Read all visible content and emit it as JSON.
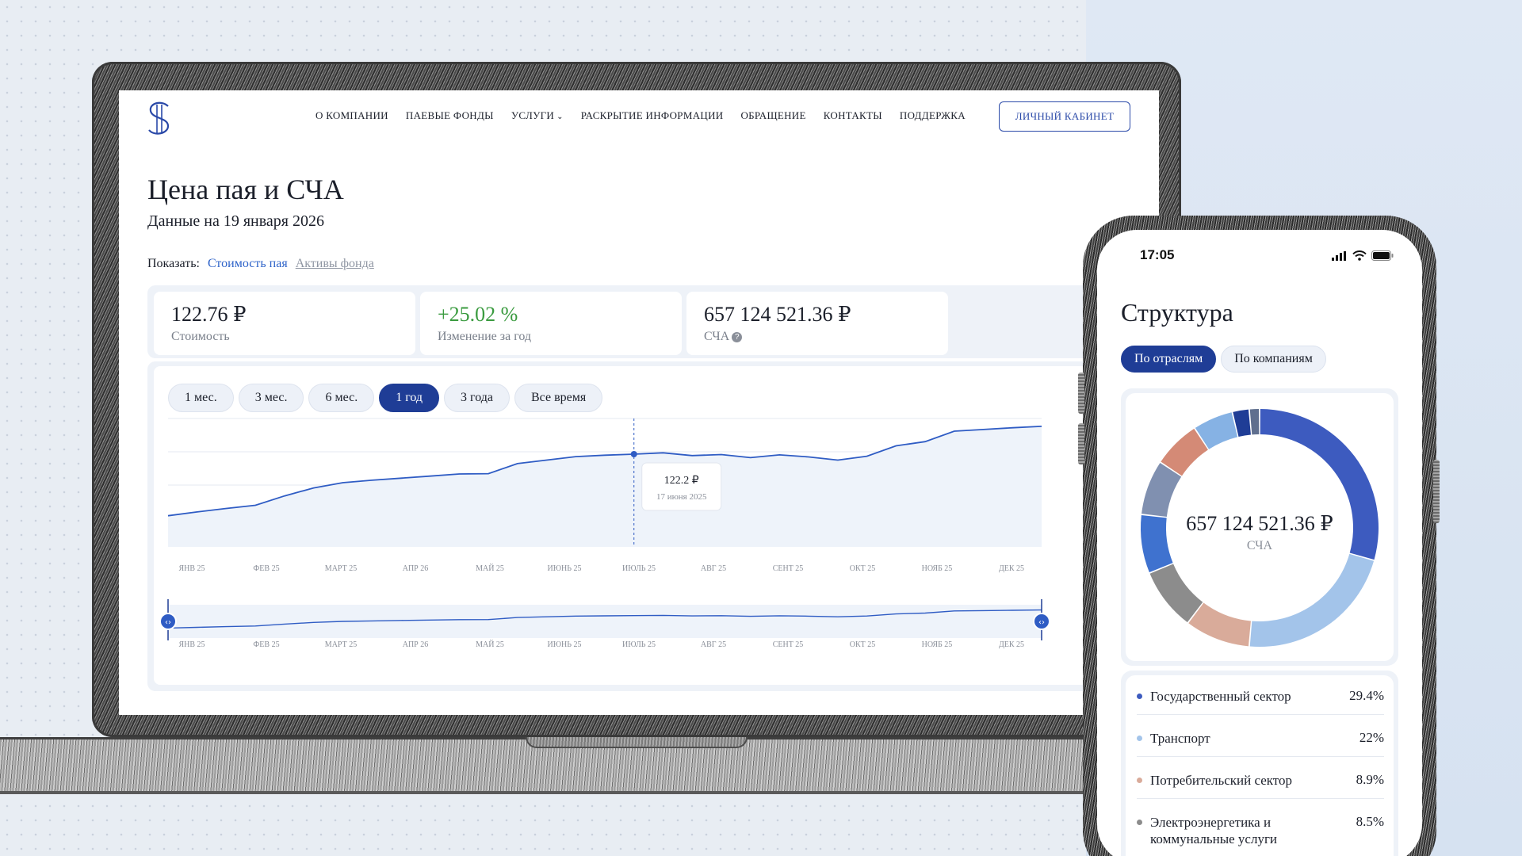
{
  "nav": {
    "items": [
      {
        "label": "О КОМПАНИИ"
      },
      {
        "label": "ПАЕВЫЕ ФОНДЫ"
      },
      {
        "label": "УСЛУГИ",
        "dropdown": true
      },
      {
        "label": "РАСКРЫТИЕ ИНФОРМАЦИИ"
      },
      {
        "label": "ОБРАЩЕНИЕ"
      },
      {
        "label": "КОНТАКТЫ"
      },
      {
        "label": "ПОДДЕРЖКА"
      }
    ],
    "cabinet_label": "ЛИЧНЫЙ КАБИНЕТ"
  },
  "page": {
    "title": "Цена пая и СЧА",
    "subtitle": "Данные на 19 января 2026",
    "show_label": "Показать:",
    "show_options": [
      "Стоимость пая",
      "Активы фонда"
    ],
    "show_selected": "Стоимость пая"
  },
  "stats": {
    "price": {
      "value": "122.76 ₽",
      "label": "Стоимость"
    },
    "change": {
      "value": "+25.02 %",
      "label": "Изменение за год"
    },
    "nav": {
      "value": "657 124 521.36 ₽",
      "label": "СЧА",
      "info_icon": "?"
    }
  },
  "periods": {
    "items": [
      "1 мес.",
      "3 мес.",
      "6 мес.",
      "1 год",
      "3 года",
      "Все время"
    ],
    "selected": "1 год"
  },
  "tooltip": {
    "value": "122.2 ₽",
    "date": "17 июня 2025"
  },
  "chart_data": {
    "type": "line",
    "x_labels": [
      "ЯНВ 25",
      "ФЕВ 25",
      "МАРТ 25",
      "АПР 26",
      "МАЙ 25",
      "ИЮНЬ 25",
      "ИЮЛЬ 25",
      "АВГ 25",
      "СЕНТ 25",
      "ОКТ 25",
      "НОЯБ 25",
      "ДЕК 25"
    ],
    "values": [
      98.5,
      99.6,
      100.6,
      101.5,
      104.2,
      106.5,
      108.0,
      108.7,
      109.3,
      109.9,
      110.5,
      110.6,
      113.5,
      114.5,
      115.5,
      115.9,
      116.2,
      116.6,
      115.8,
      116.1,
      115.2,
      116.0,
      115.4,
      114.5,
      115.6,
      118.6,
      119.8,
      122.8,
      123.3,
      123.8,
      124.2
    ],
    "highlight_index": 16,
    "line_color": "#2f5cc4",
    "fill_color": "#eef3fa"
  },
  "mobile": {
    "time": "17:05",
    "title": "Структура",
    "tabs": [
      "По отраслям",
      "По компаниям"
    ],
    "selected_tab": "По отраслям",
    "donut_value": "657 124 521.36 ₽",
    "donut_label": "СЧА",
    "structure": [
      {
        "name": "Государственный сектор",
        "pct": "29.4%",
        "value": 29.4,
        "color": "#3d5bbf"
      },
      {
        "name": "Транспорт",
        "pct": "22%",
        "value": 22,
        "color": "#a3c4ea"
      },
      {
        "name": "Потребительский сектор",
        "pct": "8.9%",
        "value": 8.9,
        "color": "#d9ab9a"
      },
      {
        "name": "Электроэнергетика и коммунальные услуги",
        "pct": "8.5%",
        "value": 8.5,
        "color": "#8c8c8c"
      }
    ],
    "donut_extra_segments": [
      {
        "value": 8.0,
        "color": "#3f72cf"
      },
      {
        "value": 7.5,
        "color": "#8090b0"
      },
      {
        "value": 6.5,
        "color": "#d48a76"
      },
      {
        "value": 5.5,
        "color": "#86b2e4"
      },
      {
        "value": 2.3,
        "color": "#1f3d96"
      },
      {
        "value": 1.4,
        "color": "#5f6f8e"
      }
    ]
  }
}
